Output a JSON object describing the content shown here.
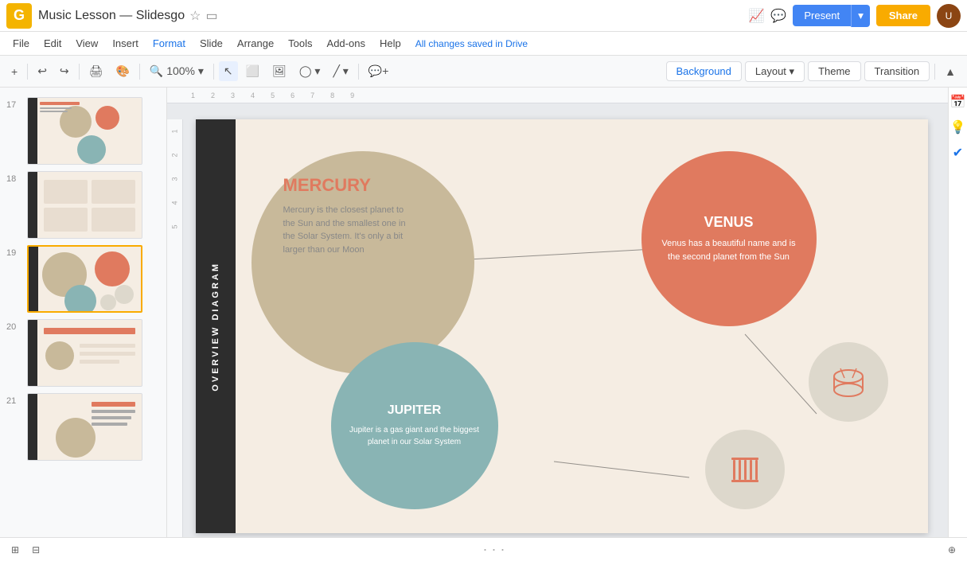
{
  "title": "Music Lesson — Slidesgo",
  "titleIcons": [
    "star",
    "folder"
  ],
  "menu": {
    "items": [
      "File",
      "Edit",
      "View",
      "Insert",
      "Format",
      "Slide",
      "Arrange",
      "Tools",
      "Add-ons",
      "Help"
    ],
    "changesStatus": "All changes saved in Drive"
  },
  "toolbar": {
    "zoomLevel": "100%",
    "buttons": [
      "Background",
      "Layout",
      "Theme",
      "Transition"
    ]
  },
  "header": {
    "presentLabel": "Present",
    "shareLabel": "Share"
  },
  "sidebar": {
    "slides": [
      {
        "num": "17",
        "selected": false
      },
      {
        "num": "18",
        "selected": false
      },
      {
        "num": "19",
        "selected": true
      },
      {
        "num": "20",
        "selected": false
      },
      {
        "num": "21",
        "selected": false
      }
    ]
  },
  "slide": {
    "sidebarLabel": "Overview Diagram",
    "mercury": {
      "title": "MERCURY",
      "description": "Mercury is the closest planet to the Sun and the smallest one in the Solar System. It's only a bit larger than our Moon"
    },
    "venus": {
      "title": "VENUS",
      "description": "Venus has a beautiful name and is the second planet from the Sun"
    },
    "jupiter": {
      "title": "JUPITER",
      "description": "Jupiter is a gas giant and the biggest planet in our Solar System"
    }
  },
  "bottomBar": {
    "dots": "· · ·"
  },
  "rightPanel": {
    "icons": [
      "calendar",
      "bulb",
      "checkmark"
    ]
  }
}
